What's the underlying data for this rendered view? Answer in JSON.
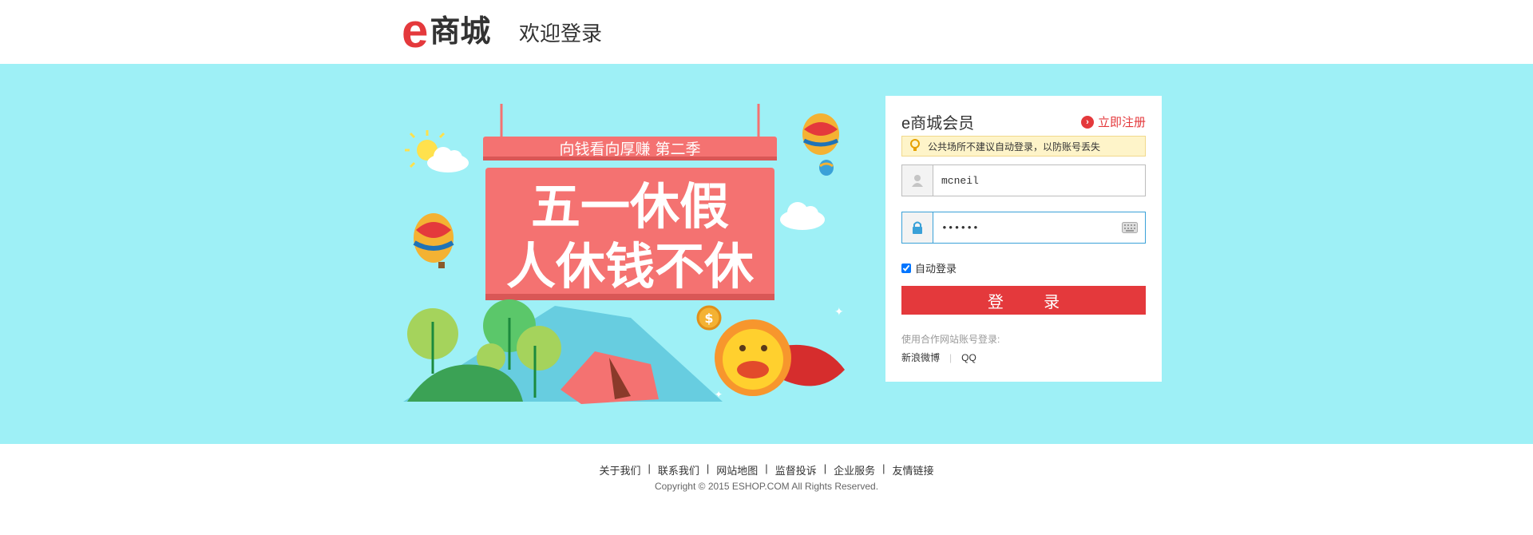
{
  "header": {
    "logo_e": "e",
    "logo_text": "商城",
    "welcome": "欢迎登录"
  },
  "promo": {
    "sign_top": "向钱看向厚赚  第二季",
    "line1": "五一休假",
    "line2": "人休钱不休",
    "coin": "$"
  },
  "login": {
    "title": "e商城会员",
    "register": "立即注册",
    "notice": "公共场所不建议自动登录，以防账号丢失",
    "username": "mcneil",
    "password": "••••••",
    "auto_login": "自动登录",
    "submit": "登 录",
    "partner_label": "使用合作网站账号登录:",
    "partners": [
      "新浪微博",
      "QQ"
    ]
  },
  "footer": {
    "links": [
      "关于我们",
      "联系我们",
      "网站地图",
      "监督投诉",
      "企业服务",
      "友情链接"
    ],
    "copyright": "Copyright © 2015 ESHOP.COM All Rights Reserved."
  },
  "colors": {
    "brand": "#e4393c",
    "banner_bg": "#9ef0f6",
    "sign": "#f47271"
  }
}
